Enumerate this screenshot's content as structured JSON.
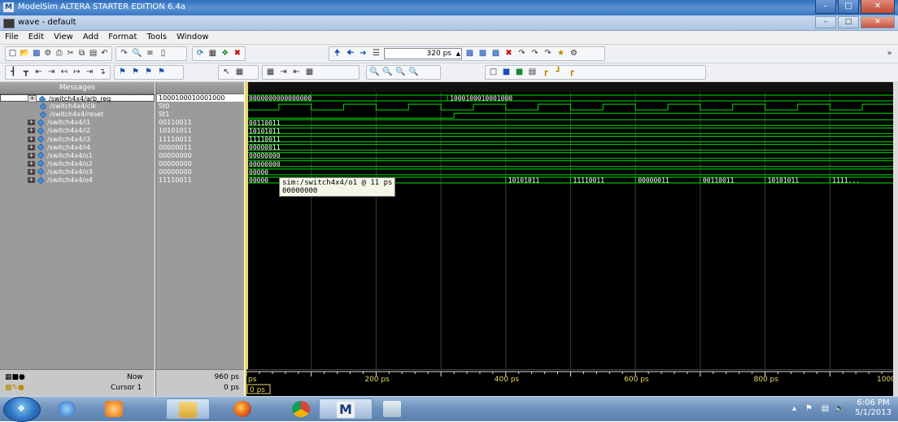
{
  "app": {
    "title": "ModelSim ALTERA STARTER EDITION 6.4a",
    "logo": "M"
  },
  "subwindow": {
    "title": "wave - default"
  },
  "window_buttons": [
    "–",
    "□",
    "✕"
  ],
  "menu": [
    "File",
    "Edit",
    "View",
    "Add",
    "Format",
    "Tools",
    "Window"
  ],
  "toolbar": {
    "zoom_value": "320 ps"
  },
  "messages_header": "Messages",
  "signals": [
    {
      "name": "/switch4x4/arb_req",
      "value": "1000100010001000"
    },
    {
      "name": "/switch4x4/clk",
      "value": "St0"
    },
    {
      "name": "/switch4x4/reset",
      "value": "St1"
    },
    {
      "name": "/switch4x4/i1",
      "value": "00110011"
    },
    {
      "name": "/switch4x4/i2",
      "value": "10101011"
    },
    {
      "name": "/switch4x4/i3",
      "value": "11110011"
    },
    {
      "name": "/switch4x4/i4",
      "value": "00000011"
    },
    {
      "name": "/switch4x4/o1",
      "value": "00000000"
    },
    {
      "name": "/switch4x4/o2",
      "value": "00000000"
    },
    {
      "name": "/switch4x4/o3",
      "value": "00000000"
    },
    {
      "name": "/switch4x4/o4",
      "value": "11110011"
    }
  ],
  "wave_labels": {
    "arb_req": [
      "0000000000000000",
      "1000100010001000"
    ],
    "i1": "00110011",
    "i2": "10101011",
    "i3": "11110011",
    "i4": "00000011",
    "o1": "00000000",
    "o2": "00000000",
    "o3": "00000",
    "o4": [
      "00000",
      "10101011",
      "11110011",
      "00000011",
      "00110011",
      "10101011",
      "1111..."
    ]
  },
  "tooltip": {
    "line1": "sim:/switch4x4/o1 @ 11 ps",
    "line2": "00000000"
  },
  "bottom": {
    "now_label": "Now",
    "now_value": "960 ps",
    "cursor_label": "Cursor 1",
    "cursor_value": "0 ps",
    "cursor_marker": "0 ps"
  },
  "timeline": {
    "start_label": "ps",
    "ticks": [
      "200 ps",
      "400 ps",
      "600 ps",
      "800 ps",
      "1000"
    ]
  },
  "wave_colors": {
    "signal": "#00e000",
    "background": "#000000",
    "cursor": "#e8d96a",
    "grid": "#3a3a3a"
  },
  "taskbar": {
    "apps": [
      "start-orb",
      "internet-explorer-icon",
      "media-player-icon",
      "file-explorer-icon",
      "firefox-icon",
      "chrome-icon",
      "modelsim-icon",
      "calculator-icon"
    ],
    "time": "6:06 PM",
    "date": "5/1/2013"
  }
}
